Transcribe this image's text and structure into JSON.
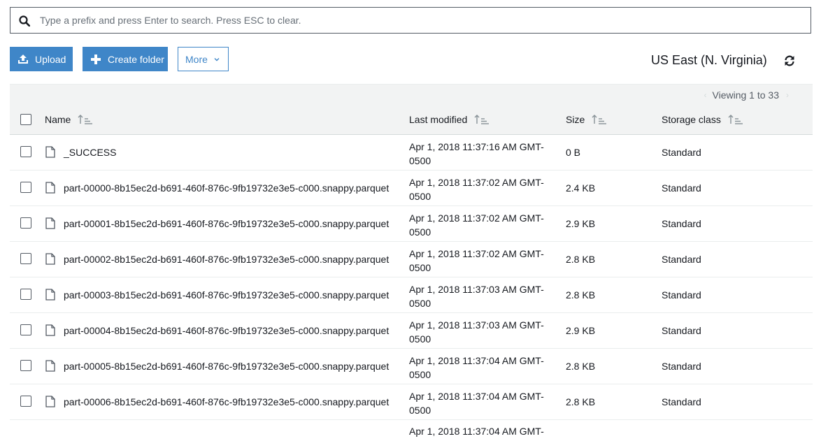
{
  "search": {
    "placeholder": "Type a prefix and press Enter to search. Press ESC to clear."
  },
  "toolbar": {
    "upload_label": "Upload",
    "create_folder_label": "Create folder",
    "more_label": "More",
    "region": "US East (N. Virginia)"
  },
  "pager": {
    "text": "Viewing 1 to 33"
  },
  "columns": {
    "name": "Name",
    "last_modified": "Last modified",
    "size": "Size",
    "storage_class": "Storage class"
  },
  "files": [
    {
      "name": "_SUCCESS",
      "modified": "Apr 1, 2018 11:37:16 AM GMT-0500",
      "size": "0 B",
      "storage_class": "Standard"
    },
    {
      "name": "part-00000-8b15ec2d-b691-460f-876c-9fb19732e3e5-c000.snappy.parquet",
      "modified": "Apr 1, 2018 11:37:02 AM GMT-0500",
      "size": "2.4 KB",
      "storage_class": "Standard"
    },
    {
      "name": "part-00001-8b15ec2d-b691-460f-876c-9fb19732e3e5-c000.snappy.parquet",
      "modified": "Apr 1, 2018 11:37:02 AM GMT-0500",
      "size": "2.9 KB",
      "storage_class": "Standard"
    },
    {
      "name": "part-00002-8b15ec2d-b691-460f-876c-9fb19732e3e5-c000.snappy.parquet",
      "modified": "Apr 1, 2018 11:37:02 AM GMT-0500",
      "size": "2.8 KB",
      "storage_class": "Standard"
    },
    {
      "name": "part-00003-8b15ec2d-b691-460f-876c-9fb19732e3e5-c000.snappy.parquet",
      "modified": "Apr 1, 2018 11:37:03 AM GMT-0500",
      "size": "2.8 KB",
      "storage_class": "Standard"
    },
    {
      "name": "part-00004-8b15ec2d-b691-460f-876c-9fb19732e3e5-c000.snappy.parquet",
      "modified": "Apr 1, 2018 11:37:03 AM GMT-0500",
      "size": "2.9 KB",
      "storage_class": "Standard"
    },
    {
      "name": "part-00005-8b15ec2d-b691-460f-876c-9fb19732e3e5-c000.snappy.parquet",
      "modified": "Apr 1, 2018 11:37:04 AM GMT-0500",
      "size": "2.8 KB",
      "storage_class": "Standard"
    },
    {
      "name": "part-00006-8b15ec2d-b691-460f-876c-9fb19732e3e5-c000.snappy.parquet",
      "modified": "Apr 1, 2018 11:37:04 AM GMT-0500",
      "size": "2.8 KB",
      "storage_class": "Standard"
    }
  ],
  "partial_row": {
    "modified": "Apr 1, 2018 11:37:04 AM GMT-"
  },
  "icons": {
    "search": "search-icon",
    "upload": "upload-icon",
    "create_folder": "plus-icon",
    "more": "chevron-down-icon",
    "refresh": "refresh-icon",
    "sort": "sort-icon",
    "file": "file-icon"
  },
  "colors": {
    "accent": "#3f86c8",
    "header_bg": "#f2f3f3",
    "text": "#16191f"
  }
}
